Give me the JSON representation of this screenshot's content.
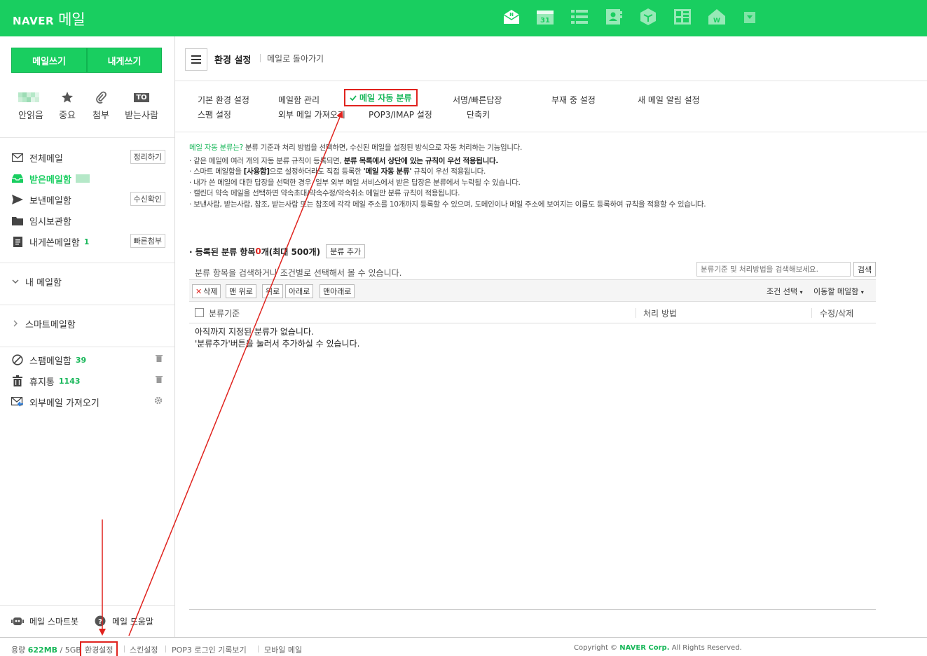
{
  "header": {
    "logo_brand": "NAVER",
    "logo_service": "메일",
    "app_icons": [
      "mail-icon",
      "calendar-icon",
      "list-icon",
      "contacts-icon",
      "cube-icon",
      "office-icon",
      "works-icon",
      "dropdown-icon"
    ],
    "calendar_day": "31"
  },
  "sidebar": {
    "compose_label": "메일쓰기",
    "self_label": "내게쓰기",
    "quick": [
      {
        "label": "안읽음",
        "icon": "unread-icon"
      },
      {
        "label": "중요",
        "icon": "star-icon"
      },
      {
        "label": "첨부",
        "icon": "paperclip-icon"
      },
      {
        "label": "받는사람",
        "icon": "to-icon",
        "badge": "TO"
      }
    ],
    "mailboxes": [
      {
        "label": "전체메일",
        "icon": "mail-icon",
        "button": "정리하기"
      },
      {
        "label": "받은메일함",
        "icon": "inbox-icon"
      },
      {
        "label": "보낸메일함",
        "icon": "send-icon",
        "button": "수신확인"
      },
      {
        "label": "임시보관함",
        "icon": "folder-icon"
      },
      {
        "label": "내게쓴메일함",
        "icon": "note-icon",
        "count": "1",
        "button": "빠른첨부"
      }
    ],
    "my_mailbox": "내 메일함",
    "smart_mailbox": "스마트메일함",
    "extra": [
      {
        "label": "스팸메일함",
        "icon": "ban-icon",
        "count": "39"
      },
      {
        "label": "휴지통",
        "icon": "trash-icon",
        "count": "1143"
      },
      {
        "label": "외부메일 가져오기",
        "icon": "import-icon"
      }
    ],
    "smartbot": "메일 스마트봇",
    "help": "메일 도움말"
  },
  "page": {
    "title": "환경 설정",
    "back": "메일로 돌아가기"
  },
  "tabs": {
    "basic": "기본 환경 설정",
    "mailbox": "메일함 관리",
    "auto_sort": "메일 자동 분류",
    "signature": "서명/빠른답장",
    "absence": "부재 중 설정",
    "new_alert": "새 메일 알림 설정",
    "spam": "스팸 설정",
    "external": "외부 메일 가져오기",
    "pop3": "POP3/IMAP 설정",
    "shortcut": "단축키"
  },
  "desc": {
    "lead_hl": "메일 자동 분류는?",
    "lead": " 분류 기준과 처리 방법을 선택하면, 수신된 메일을 설정된 방식으로 자동 처리하는 기능입니다.",
    "l1a": "· 같은 메일에 여러 개의 자동 분류 규칙이 등록되면, ",
    "l1b": "분류 목록에서 상단에 있는 규칙이 우선 적용됩니다.",
    "l2a": "· 스마트 메일함을 ",
    "l2b": "[사용함]",
    "l2c": "으로 설정하더라도 직접 등록한 ",
    "l2d": "'메일 자동 분류'",
    "l2e": " 규칙이 우선 적용됩니다.",
    "l3": "· 내가 쓴 메일에 대한 답장을 선택한 경우, 일부 외부 메일 서비스에서 받은 답장은 분류에서 누락될 수 있습니다.",
    "l4": "· 캘린더 약속 메일을 선택하면 약속초대/약속수정/약속취소 메일만 분류 규칙이 적용됩니다.",
    "l5": "· 보낸사람, 받는사람, 참조, 받는사람 또는 참조에 각각 메일 주소를 10개까지 등록할 수 있으며, 도메인이나 메일 주소에 보여지는 이름도 등록하여 규칙을 적용할 수 있습니다."
  },
  "rules": {
    "header_a": "· 등록된 분류 항목 ",
    "count": "0",
    "header_b": "개(최대 500개)",
    "add": "분류 추가",
    "search_hint": "분류 항목을 검색하거나 조건별로 선택해서 볼 수 있습니다.",
    "search_placeholder": "분류기준 및 처리방법을 검색해보세요.",
    "search_btn": "검색",
    "tb_delete": "삭제",
    "tb_top": "맨 위로",
    "tb_up": "위로",
    "tb_down": "아래로",
    "tb_bottom": "맨아래로",
    "dd_condition": "조건 선택",
    "dd_move": "이동할 메일함",
    "col_criteria": "분류기준",
    "col_action": "처리 방법",
    "col_edit": "수정/삭제",
    "empty1": "아직까지 지정된 분류가 없습니다.",
    "empty2": "'분류추가'버튼을 눌러서 추가하실 수 있습니다."
  },
  "footer": {
    "usage_label": "용량",
    "usage": "622MB",
    "quota": "/ 5GB",
    "settings": "환경설정",
    "skin": "스킨설정",
    "pop3log": "POP3 로그인 기록보기",
    "mobile": "모바일 메일",
    "copy_a": "Copyright ©",
    "copy_b": "NAVER Corp.",
    "copy_c": "All Rights Reserved."
  },
  "colors": {
    "brand": "#19ce60",
    "annotation": "#e0231e"
  }
}
